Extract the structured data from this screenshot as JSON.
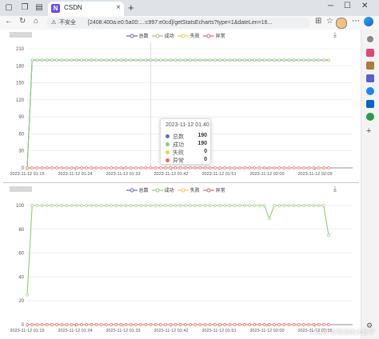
{
  "browser": {
    "tab_title": "CSDN",
    "tab_favicon": "N",
    "insecure_label": "不安全",
    "url": "[2408:400a:e0:5a00:...:c997:e0cd]/getStatsEcharts?type=1&dateLen=16...",
    "watermark": "CSDN @笑坊的大乐子"
  },
  "legend": [
    "总数",
    "成功",
    "失败",
    "异常"
  ],
  "colors": {
    "total": "#5470c6",
    "success": "#91cc75",
    "fail": "#fac858",
    "error": "#ee6666"
  },
  "tooltip": {
    "title": "2023-11-12 01:40",
    "rows": [
      {
        "name": "总数",
        "value": "190"
      },
      {
        "name": "成功",
        "value": "190"
      },
      {
        "name": "失败",
        "value": "0"
      },
      {
        "name": "异常",
        "value": "0"
      }
    ]
  },
  "chart_data": [
    {
      "type": "line",
      "ylim": [
        0,
        210
      ],
      "yticks": [
        "0",
        "30",
        "60",
        "90",
        "120",
        "150",
        "180",
        "210"
      ],
      "xlabels": [
        "2023-11-12 01:15",
        "2023-11-12 01:24",
        "2023-11-12 01:33",
        "2023-11-12 01:42",
        "2023-11-12 01:51",
        "2023-11-12 02:00",
        "2023-11-12 02:09"
      ],
      "series": [
        {
          "name": "总数",
          "values": [
            0,
            190,
            190,
            190,
            190,
            190,
            190,
            190,
            190,
            190,
            190,
            190,
            190,
            190,
            190,
            190,
            190,
            190,
            190,
            190,
            190,
            190,
            190,
            190,
            190,
            190,
            190,
            190,
            190,
            190,
            190,
            190,
            190,
            190,
            190,
            190,
            190,
            190,
            190,
            190,
            190,
            190,
            190,
            190,
            190,
            190,
            190,
            190,
            190,
            190,
            190,
            190,
            190,
            190,
            190,
            190,
            190,
            190,
            190,
            190,
            190,
            190
          ]
        },
        {
          "name": "成功",
          "values": [
            0,
            190,
            190,
            190,
            190,
            190,
            190,
            190,
            190,
            190,
            190,
            190,
            190,
            190,
            190,
            190,
            190,
            190,
            190,
            190,
            190,
            190,
            190,
            190,
            190,
            190,
            190,
            190,
            190,
            190,
            190,
            190,
            190,
            190,
            190,
            190,
            190,
            190,
            190,
            190,
            190,
            190,
            190,
            190,
            190,
            190,
            190,
            190,
            190,
            190,
            190,
            190,
            190,
            190,
            190,
            190,
            190,
            190,
            190,
            190,
            190,
            190
          ]
        },
        {
          "name": "失败",
          "values": [
            0,
            0,
            0,
            0,
            0,
            0,
            0,
            0,
            0,
            0,
            0,
            0,
            0,
            0,
            0,
            0,
            0,
            0,
            0,
            0,
            0,
            0,
            0,
            0,
            0,
            0,
            0,
            0,
            0,
            0,
            0,
            0,
            0,
            0,
            0,
            0,
            0,
            0,
            0,
            0,
            0,
            0,
            0,
            0,
            0,
            0,
            0,
            0,
            0,
            0,
            0,
            0,
            0,
            0,
            0,
            0,
            0,
            0,
            0,
            0,
            0,
            0
          ]
        },
        {
          "name": "异常",
          "values": [
            0,
            0,
            0,
            0,
            0,
            0,
            0,
            0,
            0,
            0,
            0,
            0,
            0,
            0,
            0,
            0,
            0,
            0,
            0,
            0,
            0,
            0,
            0,
            0,
            0,
            0,
            0,
            0,
            0,
            0,
            0,
            0,
            0,
            0,
            0,
            0,
            0,
            0,
            0,
            0,
            0,
            0,
            0,
            0,
            0,
            0,
            0,
            0,
            0,
            0,
            0,
            0,
            0,
            0,
            0,
            0,
            0,
            0,
            0,
            0,
            0,
            0
          ]
        }
      ],
      "highlight_index": 25
    },
    {
      "type": "line",
      "ylim": [
        0,
        100
      ],
      "yticks": [
        "0",
        "20",
        "40",
        "60",
        "80",
        "100"
      ],
      "xlabels": [
        "2023-11-12 01:15",
        "2023-11-12 01:24",
        "2023-11-12 01:33",
        "2023-11-12 01:42",
        "2023-11-12 01:51",
        "2023-11-12 02:00",
        "2023-11-12 02:09"
      ],
      "series": [
        {
          "name": "总数",
          "values": [
            0,
            0,
            0,
            0,
            0,
            0,
            0,
            0,
            0,
            0,
            0,
            0,
            0,
            0,
            0,
            0,
            0,
            0,
            0,
            0,
            0,
            0,
            0,
            0,
            0,
            0,
            0,
            0,
            0,
            0,
            0,
            0,
            0,
            0,
            0,
            0,
            0,
            0,
            0,
            0,
            0,
            0,
            0,
            0,
            0,
            0,
            0,
            0,
            0,
            0,
            0,
            0,
            0,
            0,
            0,
            0,
            0,
            0,
            0,
            0,
            0,
            0
          ]
        },
        {
          "name": "成功",
          "values": [
            25,
            100,
            100,
            100,
            100,
            100,
            100,
            100,
            100,
            100,
            100,
            100,
            100,
            100,
            100,
            100,
            100,
            100,
            100,
            100,
            100,
            100,
            100,
            100,
            100,
            100,
            100,
            100,
            100,
            100,
            100,
            100,
            100,
            100,
            100,
            100,
            100,
            100,
            100,
            100,
            100,
            100,
            100,
            100,
            100,
            100,
            100,
            100,
            100,
            89,
            100,
            100,
            100,
            100,
            100,
            100,
            100,
            100,
            100,
            100,
            100,
            75
          ]
        },
        {
          "name": "失败",
          "values": [
            0,
            0,
            0,
            0,
            0,
            0,
            0,
            0,
            0,
            0,
            0,
            0,
            0,
            0,
            0,
            0,
            0,
            0,
            0,
            0,
            0,
            0,
            0,
            0,
            0,
            0,
            0,
            0,
            0,
            0,
            0,
            0,
            0,
            0,
            0,
            0,
            0,
            0,
            0,
            0,
            0,
            0,
            0,
            0,
            0,
            0,
            0,
            0,
            0,
            0,
            0,
            0,
            0,
            0,
            0,
            0,
            0,
            0,
            0,
            0,
            0,
            0
          ]
        },
        {
          "name": "异常",
          "values": [
            0,
            0,
            0,
            0,
            0,
            0,
            0,
            0,
            0,
            0,
            0,
            0,
            0,
            0,
            0,
            0,
            0,
            0,
            0,
            0,
            0,
            0,
            0,
            0,
            0,
            0,
            0,
            0,
            0,
            0,
            0,
            0,
            0,
            0,
            0,
            0,
            0,
            0,
            0,
            0,
            0,
            0,
            0,
            0,
            0,
            0,
            0,
            0,
            0,
            0,
            0,
            0,
            0,
            0,
            0,
            0,
            0,
            0,
            0,
            0,
            0,
            0
          ]
        }
      ]
    }
  ]
}
